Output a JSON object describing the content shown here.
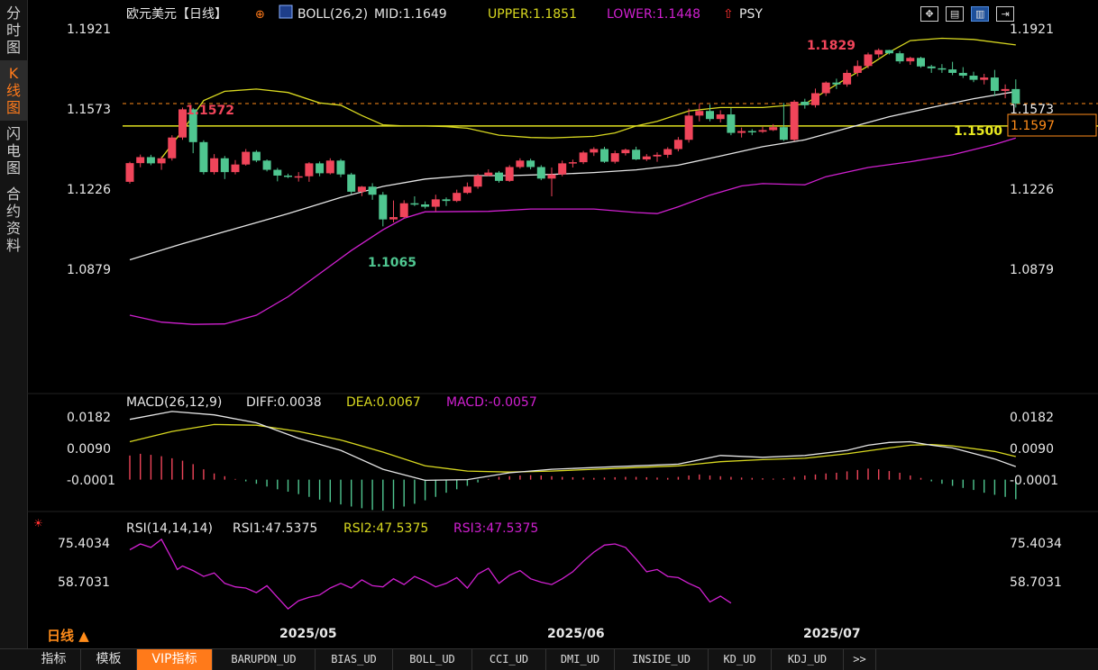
{
  "sidebar": {
    "tabs": [
      {
        "label": "分时图",
        "active": false
      },
      {
        "label": "K线图",
        "active": true
      },
      {
        "label": "闪电图",
        "active": false
      },
      {
        "label": "合约资料",
        "active": false
      }
    ]
  },
  "toolbar_icons": [
    "grid-icon",
    "table-icon",
    "kline-icon",
    "exit-icon"
  ],
  "main_panel": {
    "title": "欧元美元【日线】",
    "indicator": "BOLL(26,2)",
    "mid": "MID:1.1649",
    "upper": "UPPER:1.1851",
    "lower": "LOWER:1.1448",
    "psy": "PSY",
    "y_ticks": [
      "1.1921",
      "1.1573",
      "1.1226",
      "1.0879"
    ],
    "y_tick_values": [
      1.1921,
      1.1573,
      1.1226,
      1.0879
    ],
    "high_label": "1.1829",
    "low_label": "1.1065",
    "left_high_label": "1.1572",
    "hline_label": "1.1500",
    "price_tag": "1.1597"
  },
  "macd_panel": {
    "label": "MACD(26,12,9)",
    "diff": "DIFF:0.0038",
    "dea": "DEA:0.0067",
    "macd": "MACD:-0.0057",
    "y_ticks": [
      "0.0182",
      "0.0090",
      "-0.0001"
    ]
  },
  "rsi_panel": {
    "label": "RSI(14,14,14)",
    "rsi1": "RSI1:47.5375",
    "rsi2": "RSI2:47.5375",
    "rsi3": "RSI3:47.5375",
    "y_ticks": [
      "75.4034",
      "58.7031"
    ]
  },
  "x_labels": [
    "2025/05",
    "2025/06",
    "2025/07"
  ],
  "period_label": "日线 ▲",
  "bottom_tabs": [
    "指标",
    "模板",
    "VIP指标",
    "BARUPDN_UD",
    "BIAS_UD",
    "BOLL_UD",
    "CCI_UD",
    "DMI_UD",
    "INSIDE_UD",
    "KD_UD",
    "KDJ_UD",
    ">>"
  ],
  "colors": {
    "up": "#f0455a",
    "down": "#4fc690",
    "mid": "#e6e6e6",
    "upper": "#d8d820",
    "lower": "#d020d0",
    "dea": "#d8d820",
    "diff": "#e6e6e6",
    "accent": "#ff7a1a"
  },
  "chart_data": {
    "type": "candlestick",
    "candles": [
      [
        1.1258,
        1.1339,
        1.125,
        1.1345
      ],
      [
        1.1339,
        1.1365,
        1.1321,
        1.1376
      ],
      [
        1.1365,
        1.1338,
        1.133,
        1.1375
      ],
      [
        1.1338,
        1.136,
        1.131,
        1.1368
      ],
      [
        1.136,
        1.145,
        1.135,
        1.146
      ],
      [
        1.145,
        1.1572,
        1.144,
        1.158
      ],
      [
        1.1572,
        1.143,
        1.1382,
        1.1578
      ],
      [
        1.143,
        1.13,
        1.129,
        1.1438
      ],
      [
        1.13,
        1.136,
        1.129,
        1.1378
      ],
      [
        1.136,
        1.13,
        1.127,
        1.137
      ],
      [
        1.13,
        1.1333,
        1.129,
        1.1352
      ],
      [
        1.1333,
        1.1388,
        1.1328,
        1.14
      ],
      [
        1.1388,
        1.135,
        1.1343,
        1.1395
      ],
      [
        1.135,
        1.131,
        1.1303,
        1.1355
      ],
      [
        1.131,
        1.1285,
        1.126,
        1.1318
      ],
      [
        1.1285,
        1.128,
        1.1274,
        1.1293
      ],
      [
        1.128,
        1.1282,
        1.1259,
        1.13
      ],
      [
        1.1282,
        1.1338,
        1.1258,
        1.1343
      ],
      [
        1.1338,
        1.1295,
        1.1282,
        1.1346
      ],
      [
        1.1295,
        1.135,
        1.129,
        1.136
      ],
      [
        1.135,
        1.129,
        1.1278,
        1.1357
      ],
      [
        1.129,
        1.1215,
        1.1205,
        1.1297
      ],
      [
        1.1215,
        1.1237,
        1.1196,
        1.124
      ],
      [
        1.1237,
        1.1202,
        1.118,
        1.1252
      ],
      [
        1.1202,
        1.1095,
        1.1065,
        1.1214
      ],
      [
        1.1095,
        1.1105,
        1.1082,
        1.1177
      ],
      [
        1.1105,
        1.1165,
        1.11,
        1.1178
      ],
      [
        1.1165,
        1.116,
        1.1153,
        1.1195
      ],
      [
        1.116,
        1.115,
        1.1142,
        1.1173
      ],
      [
        1.115,
        1.1182,
        1.113,
        1.1202
      ],
      [
        1.1182,
        1.1175,
        1.1153,
        1.119
      ],
      [
        1.1175,
        1.121,
        1.117,
        1.1224
      ],
      [
        1.121,
        1.1237,
        1.1205,
        1.1255
      ],
      [
        1.1237,
        1.1285,
        1.1228,
        1.1293
      ],
      [
        1.1285,
        1.1298,
        1.1282,
        1.1312
      ],
      [
        1.1298,
        1.1262,
        1.1254,
        1.1305
      ],
      [
        1.1262,
        1.1322,
        1.1258,
        1.133
      ],
      [
        1.1322,
        1.135,
        1.1315,
        1.136
      ],
      [
        1.135,
        1.1322,
        1.1312,
        1.1358
      ],
      [
        1.1322,
        1.1272,
        1.1265,
        1.133
      ],
      [
        1.1272,
        1.129,
        1.1195,
        1.132
      ],
      [
        1.129,
        1.1338,
        1.1282,
        1.135
      ],
      [
        1.1338,
        1.1343,
        1.132,
        1.1354
      ],
      [
        1.1343,
        1.1385,
        1.1335,
        1.1392
      ],
      [
        1.1385,
        1.14,
        1.137,
        1.1408
      ],
      [
        1.14,
        1.1345,
        1.134,
        1.141
      ],
      [
        1.1345,
        1.1382,
        1.1337,
        1.1393
      ],
      [
        1.1382,
        1.1397,
        1.1372,
        1.1402
      ],
      [
        1.1397,
        1.1355,
        1.1352,
        1.141
      ],
      [
        1.1355,
        1.1368,
        1.1348,
        1.1378
      ],
      [
        1.1368,
        1.1375,
        1.1345,
        1.1386
      ],
      [
        1.1375,
        1.14,
        1.1362,
        1.1408
      ],
      [
        1.14,
        1.144,
        1.139,
        1.1452
      ],
      [
        1.144,
        1.1545,
        1.1428,
        1.1575
      ],
      [
        1.1545,
        1.1565,
        1.152,
        1.1596
      ],
      [
        1.1565,
        1.153,
        1.152,
        1.1593
      ],
      [
        1.153,
        1.155,
        1.1515,
        1.1568
      ],
      [
        1.155,
        1.147,
        1.146,
        1.1578
      ],
      [
        1.147,
        1.1478,
        1.145,
        1.1493
      ],
      [
        1.1478,
        1.1475,
        1.146,
        1.1486
      ],
      [
        1.1475,
        1.1482,
        1.147,
        1.1496
      ],
      [
        1.1482,
        1.1495,
        1.1478,
        1.1508
      ],
      [
        1.1495,
        1.144,
        1.1435,
        1.16
      ],
      [
        1.144,
        1.1605,
        1.1435,
        1.1612
      ],
      [
        1.1605,
        1.159,
        1.1575,
        1.1618
      ],
      [
        1.159,
        1.1642,
        1.158,
        1.1662
      ],
      [
        1.1642,
        1.1688,
        1.163,
        1.1693
      ],
      [
        1.1688,
        1.168,
        1.166,
        1.1705
      ],
      [
        1.168,
        1.173,
        1.167,
        1.1743
      ],
      [
        1.173,
        1.176,
        1.1715,
        1.1784
      ],
      [
        1.176,
        1.181,
        1.175,
        1.1818
      ],
      [
        1.181,
        1.1829,
        1.1796,
        1.1836
      ],
      [
        1.1829,
        1.1815,
        1.181,
        1.183
      ],
      [
        1.1815,
        1.178,
        1.177,
        1.1825
      ],
      [
        1.178,
        1.1795,
        1.1765,
        1.18
      ],
      [
        1.1795,
        1.1758,
        1.1752,
        1.18
      ],
      [
        1.1758,
        1.175,
        1.173,
        1.1765
      ],
      [
        1.175,
        1.1745,
        1.173,
        1.1768
      ],
      [
        1.1745,
        1.173,
        1.172,
        1.1778
      ],
      [
        1.173,
        1.1718,
        1.1708,
        1.1755
      ],
      [
        1.1718,
        1.17,
        1.169,
        1.1735
      ],
      [
        1.17,
        1.171,
        1.168,
        1.1726
      ],
      [
        1.171,
        1.1652,
        1.163,
        1.1743
      ],
      [
        1.1652,
        1.166,
        1.162,
        1.168
      ],
      [
        1.166,
        1.1597,
        1.158,
        1.1702
      ]
    ],
    "boll_mid": [
      [
        0,
        1.092
      ],
      [
        5,
        1.099
      ],
      [
        10,
        1.1055
      ],
      [
        15,
        1.112
      ],
      [
        20,
        1.119
      ],
      [
        24,
        1.1238
      ],
      [
        28,
        1.127
      ],
      [
        32,
        1.1285
      ],
      [
        36,
        1.1285
      ],
      [
        40,
        1.129
      ],
      [
        44,
        1.1298
      ],
      [
        48,
        1.131
      ],
      [
        52,
        1.133
      ],
      [
        56,
        1.137
      ],
      [
        60,
        1.141
      ],
      [
        64,
        1.144
      ],
      [
        68,
        1.149
      ],
      [
        72,
        1.154
      ],
      [
        76,
        1.158
      ],
      [
        80,
        1.1618
      ],
      [
        84,
        1.1649
      ]
    ],
    "boll_upper": [
      [
        3,
        1.136
      ],
      [
        5,
        1.148
      ],
      [
        7,
        1.161
      ],
      [
        9,
        1.165
      ],
      [
        12,
        1.166
      ],
      [
        15,
        1.1645
      ],
      [
        18,
        1.16
      ],
      [
        20,
        1.159
      ],
      [
        22,
        1.1545
      ],
      [
        24,
        1.1505
      ],
      [
        26,
        1.15
      ],
      [
        28,
        1.15
      ],
      [
        30,
        1.1497
      ],
      [
        32,
        1.149
      ],
      [
        35,
        1.146
      ],
      [
        38,
        1.145
      ],
      [
        40,
        1.1448
      ],
      [
        44,
        1.1455
      ],
      [
        46,
        1.147
      ],
      [
        48,
        1.15
      ],
      [
        50,
        1.152
      ],
      [
        53,
        1.1565
      ],
      [
        56,
        1.158
      ],
      [
        60,
        1.158
      ],
      [
        64,
        1.1595
      ],
      [
        67,
        1.168
      ],
      [
        70,
        1.176
      ],
      [
        72,
        1.182
      ],
      [
        74,
        1.187
      ],
      [
        77,
        1.188
      ],
      [
        80,
        1.1875
      ],
      [
        84,
        1.1851
      ]
    ],
    "boll_lower": [
      [
        0,
        1.068
      ],
      [
        3,
        1.065
      ],
      [
        6,
        1.064
      ],
      [
        9,
        1.0642
      ],
      [
        12,
        1.068
      ],
      [
        15,
        1.076
      ],
      [
        18,
        1.086
      ],
      [
        21,
        1.096
      ],
      [
        24,
        1.105
      ],
      [
        26,
        1.11
      ],
      [
        28,
        1.1128
      ],
      [
        34,
        1.113
      ],
      [
        38,
        1.114
      ],
      [
        44,
        1.114
      ],
      [
        48,
        1.1125
      ],
      [
        50,
        1.112
      ],
      [
        52,
        1.115
      ],
      [
        55,
        1.12
      ],
      [
        58,
        1.124
      ],
      [
        60,
        1.125
      ],
      [
        64,
        1.1245
      ],
      [
        66,
        1.128
      ],
      [
        70,
        1.132
      ],
      [
        74,
        1.1345
      ],
      [
        78,
        1.1375
      ],
      [
        82,
        1.142
      ],
      [
        84,
        1.1448
      ]
    ],
    "hline": 1.15,
    "dashed_line": 1.1597,
    "macd": {
      "ylim": [
        -0.005,
        0.022
      ],
      "diff": [
        [
          0,
          0.0175
        ],
        [
          4,
          0.0198
        ],
        [
          8,
          0.0188
        ],
        [
          12,
          0.0165
        ],
        [
          16,
          0.012
        ],
        [
          20,
          0.0085
        ],
        [
          24,
          0.003
        ],
        [
          28,
          -0.0002
        ],
        [
          32,
          0.0
        ],
        [
          36,
          0.002
        ],
        [
          40,
          0.003
        ],
        [
          44,
          0.0035
        ],
        [
          48,
          0.004
        ],
        [
          52,
          0.0045
        ],
        [
          56,
          0.007
        ],
        [
          60,
          0.0065
        ],
        [
          64,
          0.007
        ],
        [
          68,
          0.0085
        ],
        [
          70,
          0.01
        ],
        [
          72,
          0.0108
        ],
        [
          74,
          0.011
        ],
        [
          76,
          0.01
        ],
        [
          78,
          0.0092
        ],
        [
          82,
          0.006
        ],
        [
          84,
          0.0038
        ]
      ],
      "dea": [
        [
          0,
          0.011
        ],
        [
          4,
          0.014
        ],
        [
          8,
          0.016
        ],
        [
          12,
          0.0158
        ],
        [
          16,
          0.014
        ],
        [
          20,
          0.0115
        ],
        [
          24,
          0.008
        ],
        [
          28,
          0.004
        ],
        [
          32,
          0.0025
        ],
        [
          36,
          0.0022
        ],
        [
          40,
          0.0025
        ],
        [
          44,
          0.003
        ],
        [
          48,
          0.0035
        ],
        [
          52,
          0.004
        ],
        [
          56,
          0.0052
        ],
        [
          60,
          0.0058
        ],
        [
          64,
          0.0062
        ],
        [
          68,
          0.0075
        ],
        [
          72,
          0.0092
        ],
        [
          74,
          0.01
        ],
        [
          76,
          0.0102
        ],
        [
          78,
          0.0098
        ],
        [
          82,
          0.0082
        ],
        [
          84,
          0.0067
        ]
      ],
      "hist": [
        0.007,
        0.0075,
        0.0072,
        0.0068,
        0.0062,
        0.0055,
        0.0045,
        0.003,
        0.0018,
        0.001,
        0.0002,
        -0.0005,
        -0.0012,
        -0.002,
        -0.0028,
        -0.0035,
        -0.0042,
        -0.005,
        -0.0058,
        -0.0065,
        -0.0072,
        -0.0078,
        -0.0083,
        -0.0088,
        -0.009,
        -0.0085,
        -0.0078,
        -0.007,
        -0.006,
        -0.005,
        -0.0038,
        -0.0028,
        -0.0018,
        -0.0008,
        0.0002,
        0.0008,
        0.001,
        0.0012,
        0.0013,
        0.0012,
        0.001,
        0.0008,
        0.0007,
        0.0006,
        0.0005,
        0.0006,
        0.0007,
        0.0008,
        0.0008,
        0.0007,
        0.0006,
        0.0005,
        0.0008,
        0.0012,
        0.0015,
        0.0012,
        0.001,
        0.0008,
        0.0006,
        0.0005,
        0.0004,
        0.0003,
        0.0004,
        0.0008,
        0.0012,
        0.0015,
        0.0018,
        0.002,
        0.0024,
        0.0028,
        0.0032,
        0.003,
        0.0025,
        0.002,
        0.0012,
        0.0005,
        -0.0005,
        -0.0012,
        -0.0018,
        -0.0024,
        -0.003,
        -0.0038,
        -0.0044,
        -0.005,
        -0.0057
      ]
    },
    "rsi": {
      "ylim": [
        44.0,
        80.0
      ],
      "values": [
        [
          0,
          72.5
        ],
        [
          2,
          75.0
        ],
        [
          4,
          73.5
        ],
        [
          6,
          77.0
        ],
        [
          8,
          68.5
        ],
        [
          9,
          64.0
        ],
        [
          10,
          65.5
        ],
        [
          12,
          63.5
        ],
        [
          14,
          61.0
        ],
        [
          16,
          62.5
        ],
        [
          18,
          58.0
        ],
        [
          20,
          56.5
        ],
        [
          22,
          56.0
        ],
        [
          24,
          54.0
        ],
        [
          26,
          57.0
        ],
        [
          28,
          52.0
        ],
        [
          30,
          47.0
        ],
        [
          32,
          50.5
        ],
        [
          34,
          52.0
        ],
        [
          36,
          53.0
        ],
        [
          38,
          56.0
        ],
        [
          40,
          58.0
        ],
        [
          42,
          56.0
        ],
        [
          44,
          59.5
        ],
        [
          46,
          57.0
        ],
        [
          48,
          56.5
        ],
        [
          50,
          60.0
        ],
        [
          52,
          57.5
        ],
        [
          54,
          61.0
        ],
        [
          56,
          59.0
        ],
        [
          58,
          56.5
        ],
        [
          60,
          58.0
        ],
        [
          62,
          60.5
        ],
        [
          64,
          56.0
        ],
        [
          66,
          62.0
        ],
        [
          68,
          64.5
        ],
        [
          70,
          58.0
        ],
        [
          72,
          61.5
        ],
        [
          74,
          63.5
        ],
        [
          76,
          60.0
        ],
        [
          78,
          58.5
        ],
        [
          80,
          57.5
        ],
        [
          82,
          60.0
        ],
        [
          84,
          63.0
        ],
        [
          86,
          67.5
        ],
        [
          88,
          71.5
        ],
        [
          90,
          74.5
        ],
        [
          92,
          75.0
        ],
        [
          94,
          73.5
        ],
        [
          96,
          68.5
        ],
        [
          98,
          63.0
        ],
        [
          100,
          64.0
        ],
        [
          102,
          61.0
        ],
        [
          104,
          60.5
        ],
        [
          106,
          58.0
        ],
        [
          108,
          56.0
        ],
        [
          110,
          50.0
        ],
        [
          112,
          52.5
        ],
        [
          114,
          49.5
        ]
      ]
    }
  }
}
